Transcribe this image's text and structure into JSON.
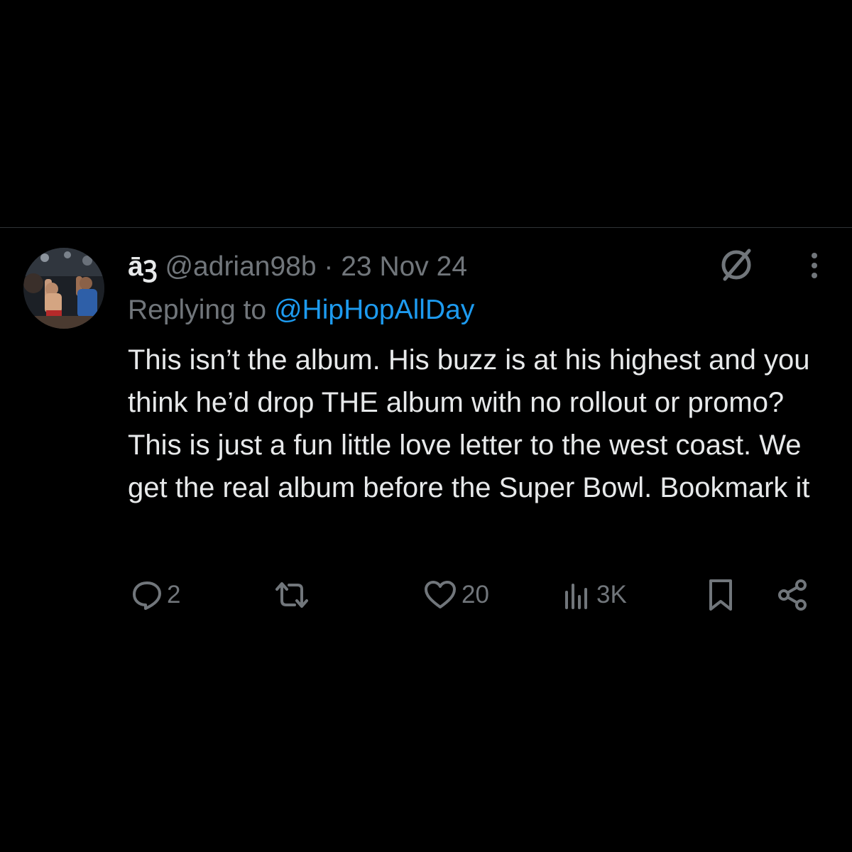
{
  "tweet": {
    "display_name": "āꝫ",
    "handle": "@adrian98b",
    "separator": "·",
    "date": "23 Nov 24",
    "replying_prefix": "Replying to",
    "replying_to": "@HipHopAllDay",
    "text": "This isn’t the album. His buzz is at his highest and you think he’d drop THE album with no rollout or promo? This is just a fun little love letter to the west coast. We get the real album before the Super Bowl. Bookmark it"
  },
  "actions": {
    "replies": "2",
    "reposts": "",
    "likes": "20",
    "views": "3K"
  },
  "icons": {
    "reply": "reply-icon",
    "repost": "repost-icon",
    "like": "heart-icon",
    "views": "views-icon",
    "bookmark": "bookmark-icon",
    "share": "share-icon",
    "grok": "grok-icon",
    "more": "more-icon"
  },
  "colors": {
    "background": "#000000",
    "primary_text": "#e7e9ea",
    "secondary_text": "#71767b",
    "link": "#1d9bf0",
    "divider": "#2f3336"
  }
}
